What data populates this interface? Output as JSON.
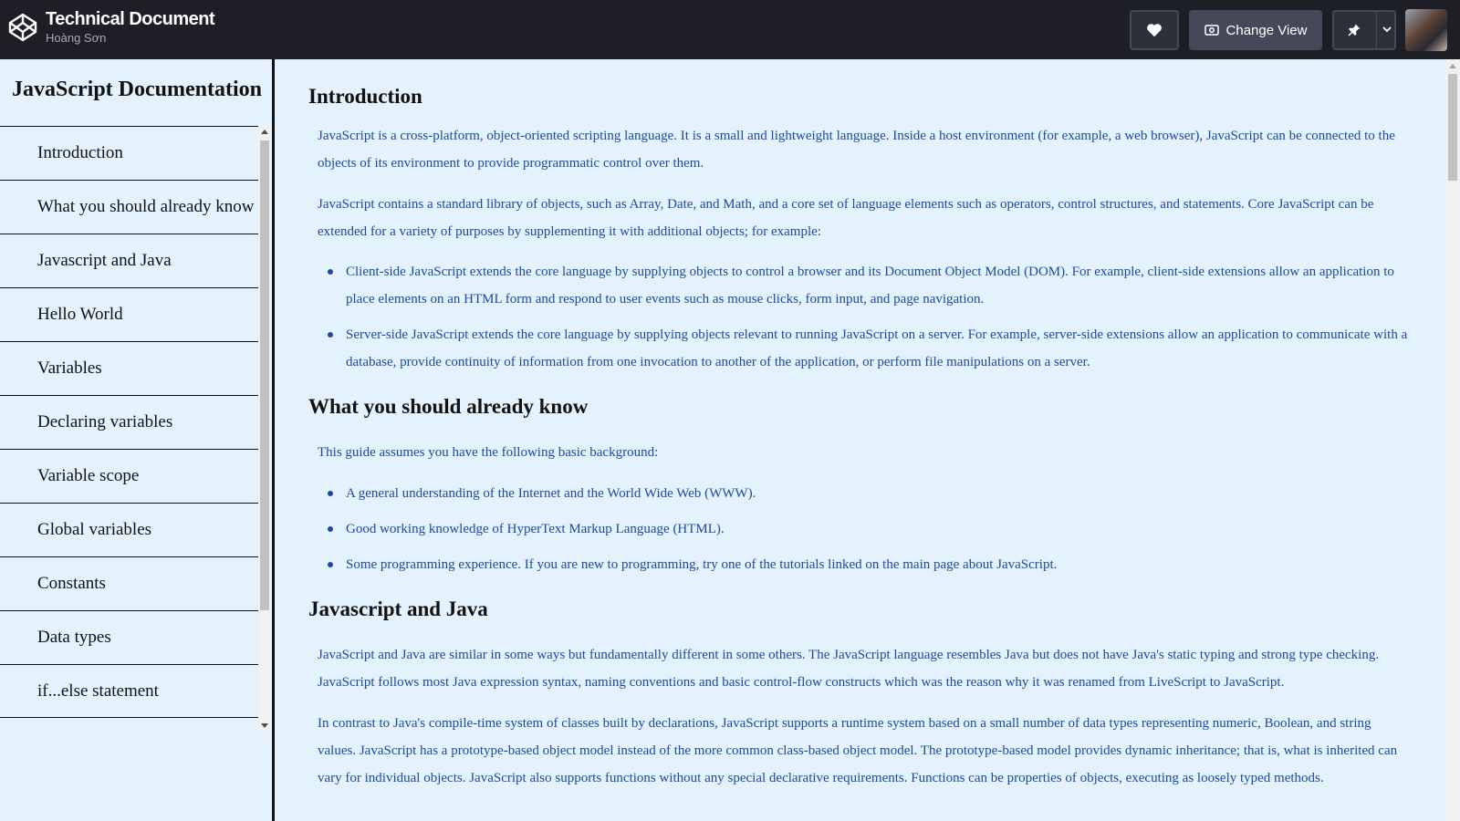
{
  "header": {
    "app_title": "Technical Document",
    "author": "Hoàng Sơn",
    "change_view_label": "Change View",
    "logo_icon": "codepen-logo-icon",
    "heart_icon": "heart-icon",
    "view_icon": "view-icon",
    "pin_icon": "pin-icon",
    "chevron_icon": "chevron-down-icon"
  },
  "sidebar": {
    "title": "JavaScript Documentation",
    "items": [
      {
        "label": "Introduction"
      },
      {
        "label": "What you should already know"
      },
      {
        "label": "Javascript and Java"
      },
      {
        "label": "Hello World"
      },
      {
        "label": "Variables"
      },
      {
        "label": "Declaring variables"
      },
      {
        "label": "Variable scope"
      },
      {
        "label": "Global variables"
      },
      {
        "label": "Constants"
      },
      {
        "label": "Data types"
      },
      {
        "label": "if...else statement"
      }
    ]
  },
  "main": {
    "sections": [
      {
        "title": "Introduction",
        "p1": "JavaScript is a cross-platform, object-oriented scripting language. It is a small and lightweight language. Inside a host environment (for example, a web browser), JavaScript can be connected to the objects of its environment to provide programmatic control over them.",
        "p2": "JavaScript contains a standard library of objects, such as Array, Date, and Math, and a core set of language elements such as operators, control structures, and statements. Core JavaScript can be extended for a variety of purposes by supplementing it with additional objects; for example:",
        "bullets": [
          "Client-side JavaScript extends the core language by supplying objects to control a browser and its Document Object Model (DOM). For example, client-side extensions allow an application to place elements on an HTML form and respond to user events such as mouse clicks, form input, and page navigation.",
          "Server-side JavaScript extends the core language by supplying objects relevant to running JavaScript on a server. For example, server-side extensions allow an application to communicate with a database, provide continuity of information from one invocation to another of the application, or perform file manipulations on a server."
        ]
      },
      {
        "title": "What you should already know",
        "p1": "This guide assumes you have the following basic background:",
        "bullets": [
          "A general understanding of the Internet and the World Wide Web (WWW).",
          "Good working knowledge of HyperText Markup Language (HTML).",
          "Some programming experience. If you are new to programming, try one of the tutorials linked on the main page about JavaScript."
        ]
      },
      {
        "title": "Javascript and Java",
        "p1": "JavaScript and Java are similar in some ways but fundamentally different in some others. The JavaScript language resembles Java but does not have Java's static typing and strong type checking. JavaScript follows most Java expression syntax, naming conventions and basic control-flow constructs which was the reason why it was renamed from LiveScript to JavaScript.",
        "p2": "In contrast to Java's compile-time system of classes built by declarations, JavaScript supports a runtime system based on a small number of data types representing numeric, Boolean, and string values. JavaScript has a prototype-based object model instead of the more common class-based object model. The prototype-based model provides dynamic inheritance; that is, what is inherited can vary for individual objects. JavaScript also supports functions without any special declarative requirements. Functions can be properties of objects, executing as loosely typed methods."
      }
    ]
  },
  "colors": {
    "topbar": "#1e1f26",
    "page_bg": "#e3f2fd",
    "body_text": "#1d4aa1",
    "button_bg": "#444857"
  }
}
